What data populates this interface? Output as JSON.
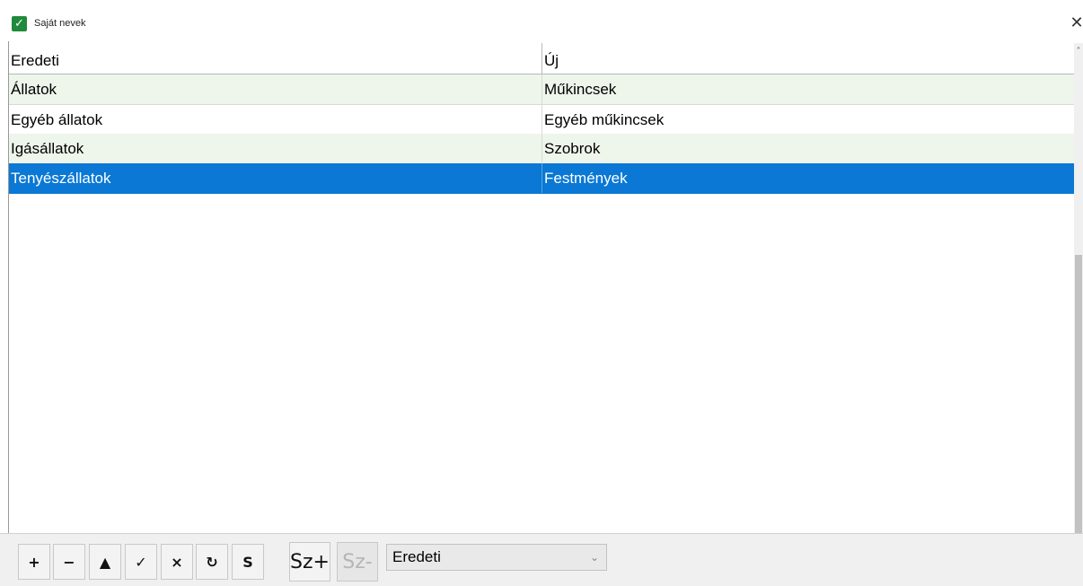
{
  "window": {
    "title": "Saját nevek",
    "close_glyph": "✕",
    "app_icon": "check-icon",
    "app_icon_glyph": "✓"
  },
  "table": {
    "columns": [
      "Eredeti",
      "Új"
    ],
    "rows": [
      {
        "eredeti": "Állatok",
        "uj": "Műkincsek"
      },
      {
        "eredeti": "Egyéb állatok",
        "uj": "Egyéb műkincsek"
      },
      {
        "eredeti": "Igásállatok",
        "uj": "Szobrok"
      },
      {
        "eredeti": "Tenyészállatok",
        "uj": "Festmények"
      }
    ],
    "selected_row": 3
  },
  "scrollbar": {
    "up_glyph": "˄",
    "down_glyph": "˅"
  },
  "toolbar": {
    "buttons": [
      {
        "name": "add-button",
        "glyph": "+"
      },
      {
        "name": "remove-button",
        "glyph": "−"
      },
      {
        "name": "move-up-button",
        "glyph": "▲"
      },
      {
        "name": "confirm-button",
        "glyph": "✓"
      },
      {
        "name": "cancel-button",
        "glyph": "×"
      },
      {
        "name": "refresh-button",
        "glyph": "↻"
      },
      {
        "name": "s-button",
        "glyph": "S"
      }
    ],
    "sz_plus": "Sz+",
    "sz_minus": "Sz-",
    "combo_value": "Eredeti",
    "combo_arrow": "⌄"
  },
  "colors": {
    "selection": "#0a78d4",
    "alt_row": "#eef6ec",
    "icon_green": "#1f8a3b"
  }
}
